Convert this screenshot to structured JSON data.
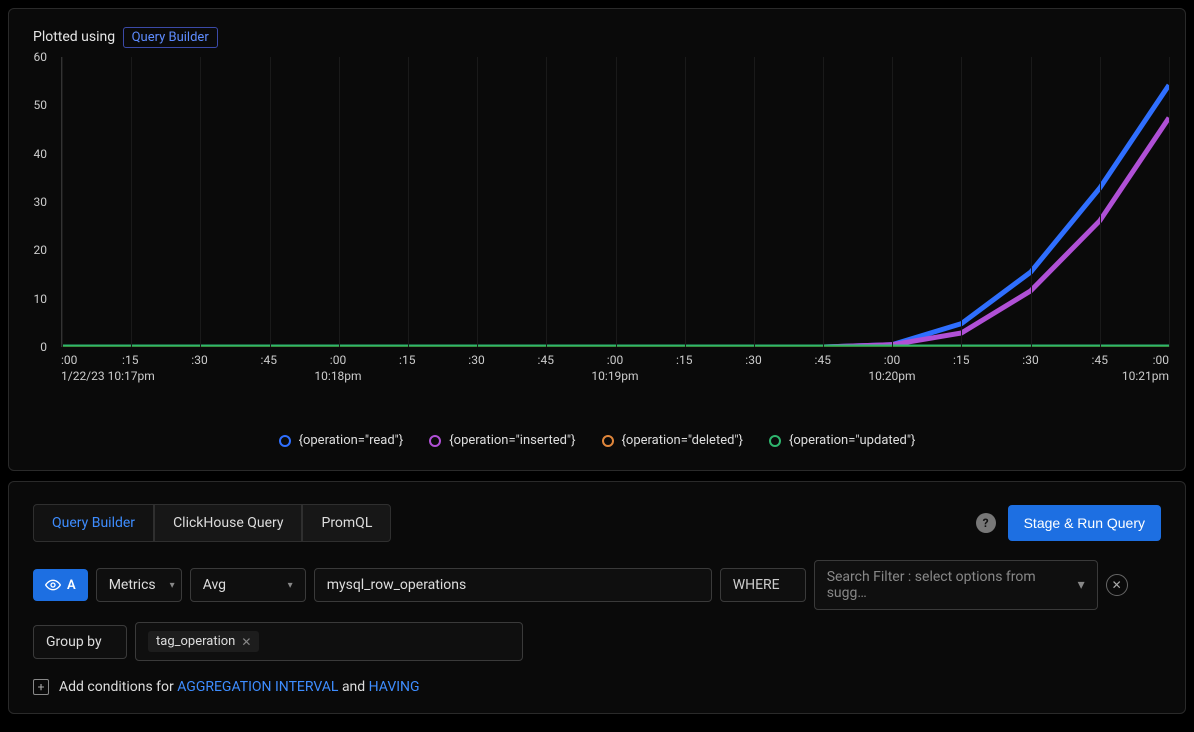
{
  "chart": {
    "header_label": "Plotted using",
    "header_badge": "Query Builder",
    "y_ticks": [
      "60",
      "50",
      "40",
      "30",
      "20",
      "10",
      "0"
    ],
    "x_ticks": [
      {
        "t": ":00",
        "sub": "1/22/23 10:17pm"
      },
      {
        "t": ":15"
      },
      {
        "t": ":30"
      },
      {
        "t": ":45"
      },
      {
        "t": ":00",
        "sub": "10:18pm"
      },
      {
        "t": ":15"
      },
      {
        "t": ":30"
      },
      {
        "t": ":45"
      },
      {
        "t": ":00",
        "sub": "10:19pm"
      },
      {
        "t": ":15"
      },
      {
        "t": ":30"
      },
      {
        "t": ":45"
      },
      {
        "t": ":00",
        "sub": "10:20pm"
      },
      {
        "t": ":15"
      },
      {
        "t": ":30"
      },
      {
        "t": ":45"
      },
      {
        "t": ":00",
        "sub": "10:21pm"
      }
    ],
    "legend": [
      {
        "label": "{operation=\"read\"}",
        "color": "#2f6fff"
      },
      {
        "label": "{operation=\"inserted\"}",
        "color": "#b050d6"
      },
      {
        "label": "{operation=\"deleted\"}",
        "color": "#e0863b"
      },
      {
        "label": "{operation=\"updated\"}",
        "color": "#2fb66e"
      }
    ]
  },
  "chart_data": {
    "type": "line",
    "title": "",
    "xlabel": "",
    "ylabel": "",
    "ylim": [
      0,
      62
    ],
    "x": [
      "10:17:00",
      "10:17:15",
      "10:17:30",
      "10:17:45",
      "10:18:00",
      "10:18:15",
      "10:18:30",
      "10:18:45",
      "10:19:00",
      "10:19:15",
      "10:19:30",
      "10:19:45",
      "10:20:00",
      "10:20:15",
      "10:20:30",
      "10:20:45",
      "10:21:00"
    ],
    "series": [
      {
        "name": "{operation=\"read\"}",
        "color": "#2f6fff",
        "values": [
          0,
          0,
          0,
          0,
          0,
          0,
          0,
          0,
          0,
          0,
          0,
          0,
          0.5,
          5,
          16,
          34,
          56
        ]
      },
      {
        "name": "{operation=\"inserted\"}",
        "color": "#b050d6",
        "values": [
          0,
          0,
          0,
          0,
          0,
          0,
          0,
          0,
          0,
          0,
          0,
          0,
          0.5,
          3,
          12,
          27,
          49
        ]
      },
      {
        "name": "{operation=\"deleted\"}",
        "color": "#e0863b",
        "values": [
          0,
          0,
          0,
          0,
          0,
          0,
          0,
          0,
          0,
          0,
          0,
          0,
          0,
          0,
          0,
          0,
          0
        ]
      },
      {
        "name": "{operation=\"updated\"}",
        "color": "#2fb66e",
        "values": [
          0,
          0,
          0,
          0,
          0,
          0,
          0,
          0,
          0,
          0,
          0,
          0,
          0,
          0,
          0,
          0,
          0
        ]
      }
    ]
  },
  "query": {
    "tabs": [
      "Query Builder",
      "ClickHouse Query",
      "PromQL"
    ],
    "active_tab": "Query Builder",
    "run_label": "Stage & Run Query",
    "series_letter": "A",
    "source": "Metrics",
    "agg": "Avg",
    "metric": "mysql_row_operations",
    "where_label": "WHERE",
    "filter_placeholder": "Search Filter : select options from sugg…",
    "groupby_label": "Group by",
    "groupby_tag": "tag_operation",
    "add_cond_prefix": "Add conditions for",
    "agg_interval": "AGGREGATION INTERVAL",
    "and_word": "and",
    "having": "HAVING"
  }
}
